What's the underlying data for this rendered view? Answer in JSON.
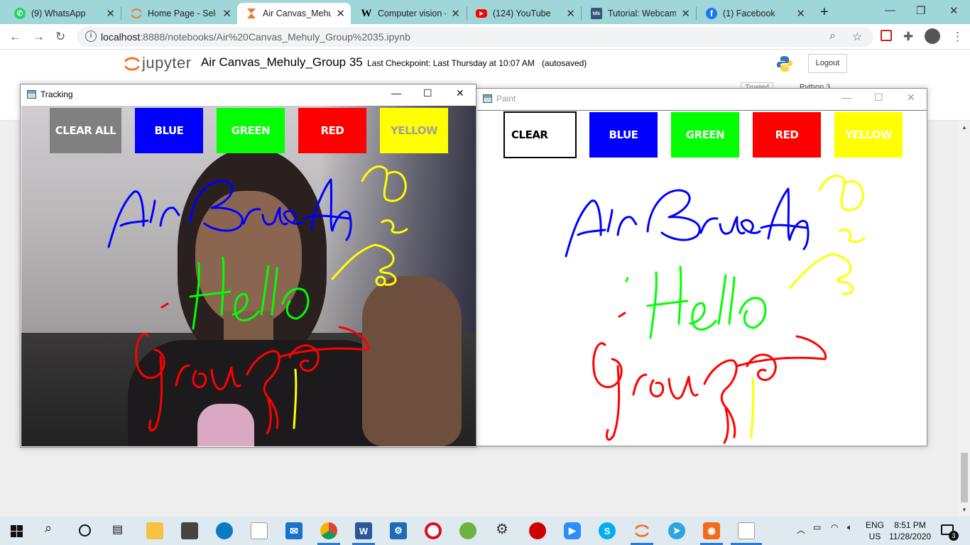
{
  "browser": {
    "tabs": [
      {
        "title": "(9) WhatsApp",
        "icon": "whatsapp-icon",
        "color": "#25d366"
      },
      {
        "title": "Home Page - Sele",
        "icon": "jupyter-icon",
        "color": "#f37726"
      },
      {
        "title": "Air Canvas_Mehuly",
        "icon": "hourglass-icon",
        "color": "#f37726",
        "active": true
      },
      {
        "title": "Computer vision -",
        "icon": "wikipedia-icon",
        "color": "#000000"
      },
      {
        "title": "(124) YouTube",
        "icon": "youtube-icon",
        "color": "#ff0000"
      },
      {
        "title": "Tutorial: Webcam",
        "icon": "tds-icon",
        "color": "#355876"
      },
      {
        "title": "(1) Facebook",
        "icon": "facebook-icon",
        "color": "#1877f2"
      }
    ],
    "url_host": "localhost",
    "url_path": ":8888/notebooks/Air%20Canvas_Mehuly_Group%2035.ipynb"
  },
  "jupyter": {
    "logo_text": "jupyter",
    "notebook_title": "Air Canvas_Mehuly_Group 35",
    "checkpoint": "Last Checkpoint: Last Thursday at 10:07 AM",
    "autosaved": "(autosaved)",
    "logout_label": "Logout",
    "trusted_label": "Trusted",
    "kernel_label": "Python 3"
  },
  "tracking_window": {
    "title": "Tracking",
    "buttons": [
      {
        "label": "CLEAR ALL",
        "bg": "#808080",
        "fg": "#ffffff"
      },
      {
        "label": "BLUE",
        "bg": "#0000ff",
        "fg": "#ffffff"
      },
      {
        "label": "GREEN",
        "bg": "#00ff00",
        "fg": "#ffffff"
      },
      {
        "label": "RED",
        "bg": "#ff0000",
        "fg": "#ffffff"
      },
      {
        "label": "YELLOW",
        "bg": "#ffff00",
        "fg": "#a0a0a0"
      }
    ]
  },
  "paint_window": {
    "title": "Paint",
    "buttons": [
      {
        "label": "CLEAR",
        "bg": "#ffffff",
        "fg": "#000000"
      },
      {
        "label": "BLUE",
        "bg": "#0000ff",
        "fg": "#ffffff"
      },
      {
        "label": "GREEN",
        "bg": "#00ff00",
        "fg": "#ffffff"
      },
      {
        "label": "RED",
        "bg": "#ff0000",
        "fg": "#ffffff"
      },
      {
        "label": "YELLOW",
        "bg": "#ffff00",
        "fg": "#ffffff"
      }
    ]
  },
  "taskbar": {
    "lang": "ENG",
    "region": "US",
    "time": "8:51 PM",
    "date": "11/28/2020",
    "notification_count": "3"
  }
}
